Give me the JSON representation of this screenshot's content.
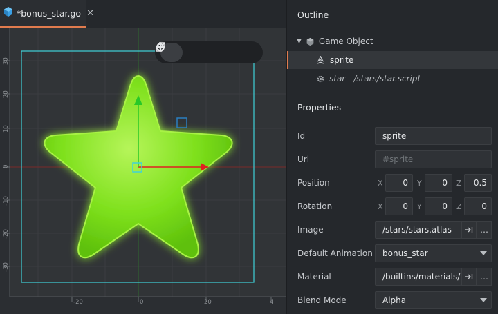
{
  "tab": {
    "title": "*bonus_star.go",
    "close_glyph": "✕"
  },
  "ruler": {
    "x_ticks": [
      "-20",
      "0",
      "20",
      "4"
    ],
    "y_ticks": [
      "30",
      "20",
      "10",
      "0",
      "-10",
      "-20",
      "-30"
    ]
  },
  "outline": {
    "title": "Outline",
    "root": "Game Object",
    "items": [
      {
        "label": "sprite",
        "selected": true
      },
      {
        "label": "star - /stars/star.script",
        "selected": false
      }
    ]
  },
  "properties": {
    "title": "Properties",
    "id": {
      "label": "Id",
      "value": "sprite"
    },
    "url": {
      "label": "Url",
      "placeholder": "#sprite"
    },
    "position": {
      "label": "Position",
      "x": "0",
      "y": "0",
      "z": "0.5"
    },
    "rotation": {
      "label": "Rotation",
      "x": "0",
      "y": "0",
      "z": "0"
    },
    "image": {
      "label": "Image",
      "value": "/stars/stars.atlas"
    },
    "default_animation": {
      "label": "Default Animation",
      "value": "bonus_star"
    },
    "material": {
      "label": "Material",
      "value": "/builtins/materials/"
    },
    "blend_mode": {
      "label": "Blend Mode",
      "value": "Alpha"
    },
    "axis_labels": {
      "x": "X",
      "y": "Y",
      "z": "Z"
    },
    "ellipsis": "…"
  },
  "colors": {
    "accent": "#e07b4e",
    "star": "#7be01a",
    "bounds": "#3fd2d8",
    "x_axis": "#e02020",
    "y_axis": "#28c828"
  }
}
